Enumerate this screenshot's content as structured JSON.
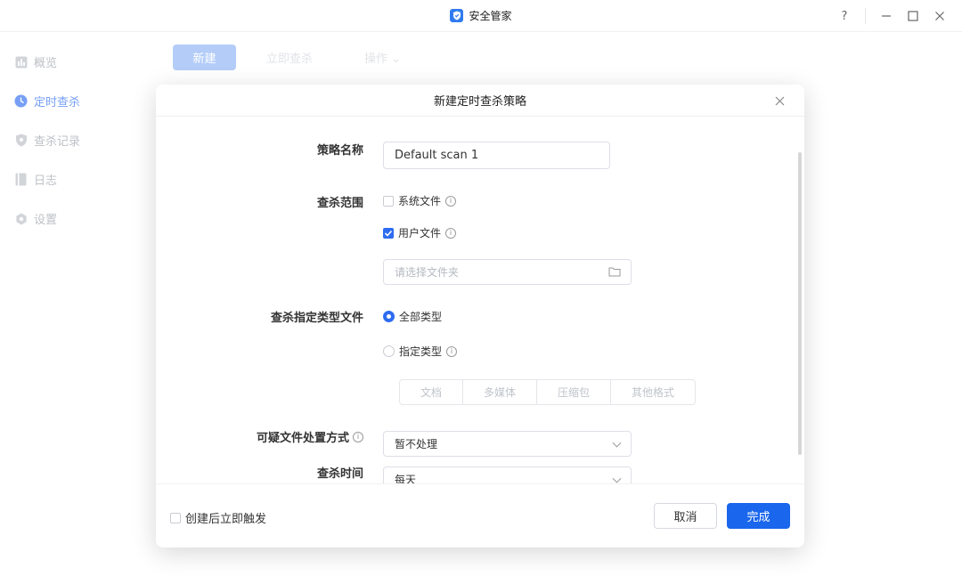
{
  "app": {
    "title": "安全管家",
    "help_glyph": "?"
  },
  "sidebar": {
    "items": [
      {
        "label": "概览",
        "icon": "overview-icon",
        "active": false
      },
      {
        "label": "定时查杀",
        "icon": "clock-icon",
        "active": true
      },
      {
        "label": "查杀记录",
        "icon": "shield-icon",
        "active": false
      },
      {
        "label": "日志",
        "icon": "log-icon",
        "active": false
      },
      {
        "label": "设置",
        "icon": "gear-icon",
        "active": false
      }
    ]
  },
  "toolbar": {
    "new_label": "新建",
    "scan_now_label": "立即查杀",
    "actions_label": "操作"
  },
  "modal": {
    "title": "新建定时查杀策略",
    "policy_name": {
      "label": "策略名称",
      "value": "Default scan 1"
    },
    "scan_scope": {
      "label": "查杀范围",
      "system_files_label": "系统文件",
      "user_files_label": "用户文件",
      "folder_placeholder": "请选择文件夹"
    },
    "file_types": {
      "label": "查杀指定类型文件",
      "all_types_label": "全部类型",
      "specific_types_label": "指定类型",
      "segments": [
        "文档",
        "多媒体",
        "压缩包",
        "其他格式"
      ]
    },
    "suspicious_action": {
      "label": "可疑文件处置方式",
      "value": "暂不处理"
    },
    "scan_time": {
      "label": "查杀时间",
      "value": "每天"
    },
    "footer": {
      "trigger_label": "创建后立即触发",
      "cancel_label": "取消",
      "done_label": "完成"
    }
  },
  "colors": {
    "accent": "#1a66ec",
    "accent_light": "#8cb3f4"
  }
}
